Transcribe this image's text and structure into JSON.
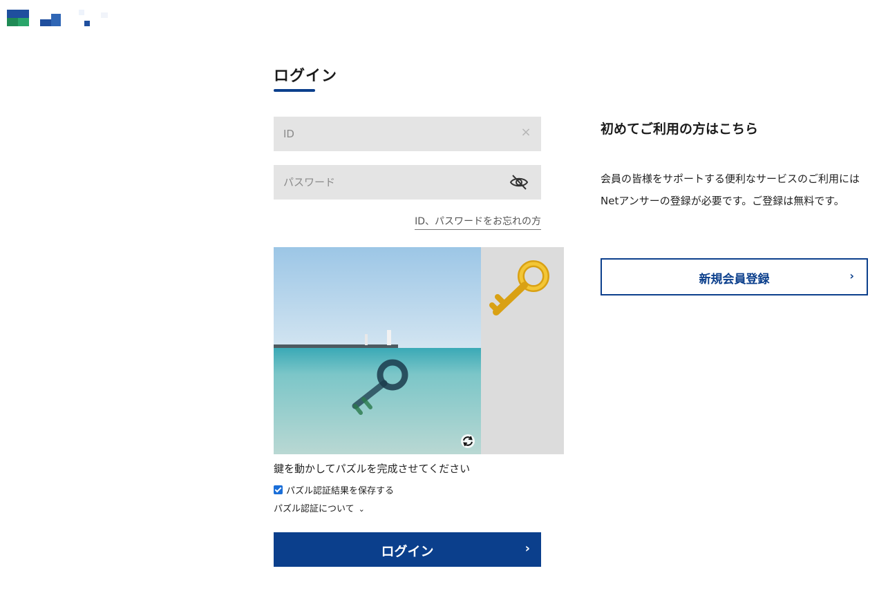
{
  "colors": {
    "brand": "#0b3f8c",
    "field_bg": "#e4e4e4",
    "checkbox": "#1a6ed8"
  },
  "login": {
    "title": "ログイン",
    "id_placeholder": "ID",
    "password_placeholder": "パスワード",
    "forgot_link": "ID、パスワードをお忘れの方",
    "puzzle_instruction": "鍵を動かしてパズルを完成させてください",
    "save_label": "パズル認証結果を保存する",
    "save_checked": true,
    "about_label": "パズル認証について",
    "submit_label": "ログイン",
    "icons": [
      "close-icon",
      "eye-off-icon",
      "refresh-icon",
      "chevron-down-icon",
      "chevron-right-icon"
    ]
  },
  "signup": {
    "title": "初めてご利用の方はこちら",
    "description": "会員の皆様をサポートする便利なサービスのご利用にはNetアンサーの登録が必要です。ご登録は無料です。",
    "register_label": "新規会員登録"
  }
}
